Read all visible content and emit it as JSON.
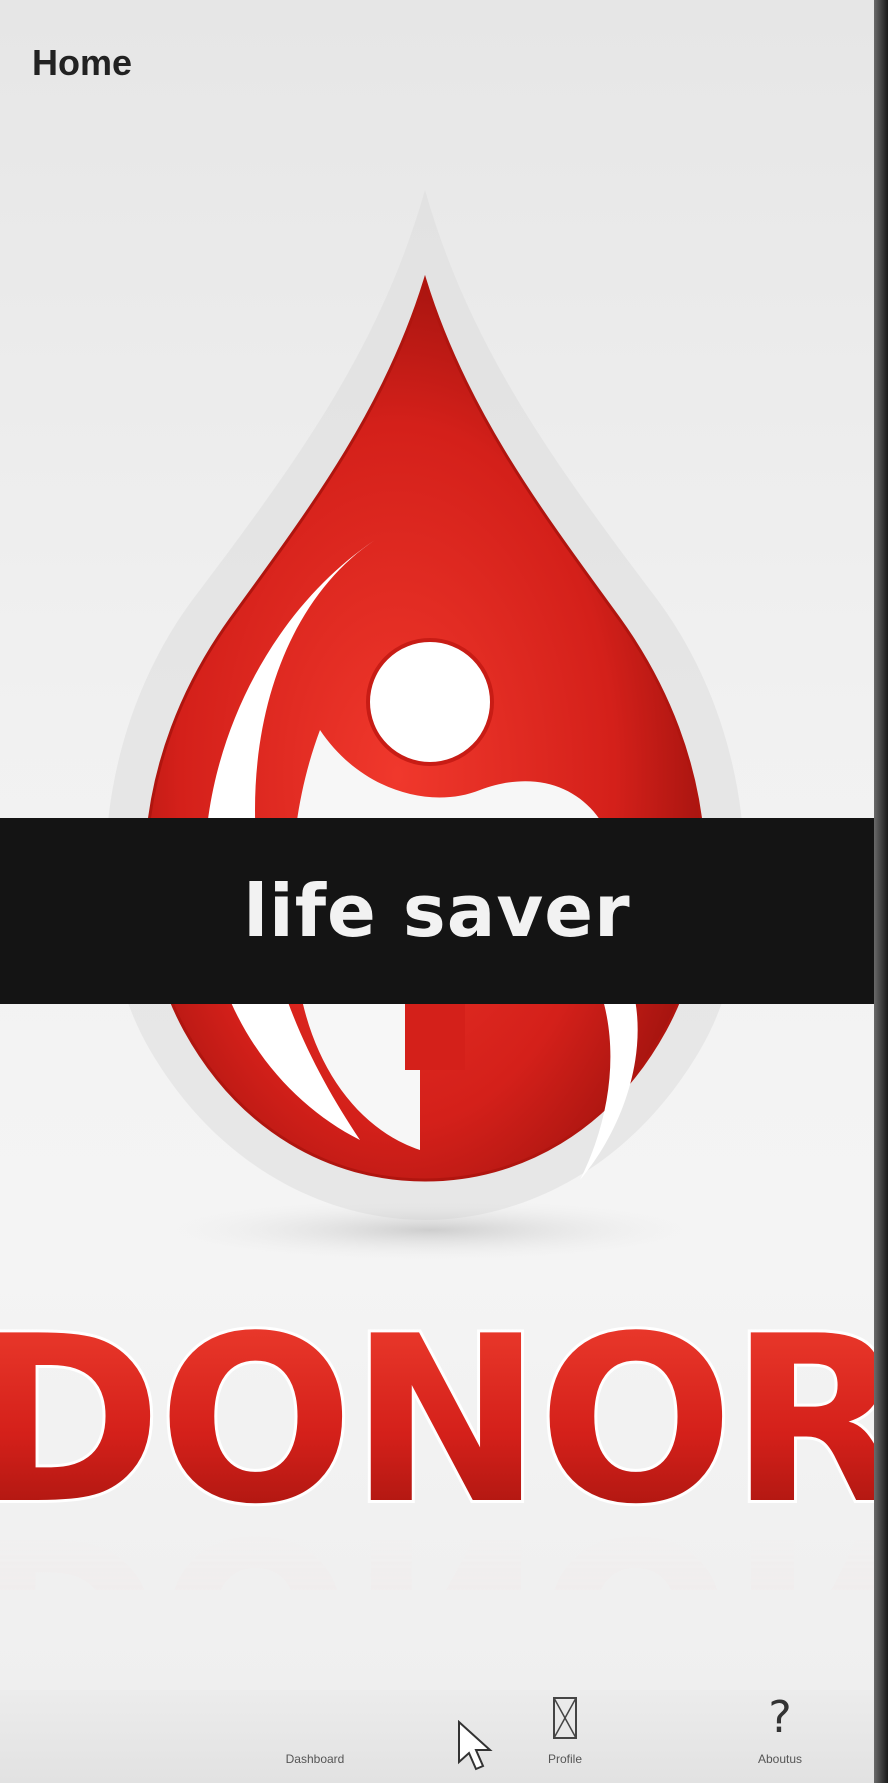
{
  "header": {
    "title": "Home"
  },
  "hero": {
    "banner_text": "life saver",
    "logo_text": "DONOR",
    "brand_red": "#d4201a",
    "brand_dark_red": "#8e0e0a"
  },
  "bottom_nav": {
    "items": [
      {
        "label": "Dashboard",
        "icon": "home-icon"
      },
      {
        "label": "Profile",
        "icon": "profile-icon"
      },
      {
        "label": "Aboutus",
        "icon": "question-icon"
      }
    ]
  }
}
